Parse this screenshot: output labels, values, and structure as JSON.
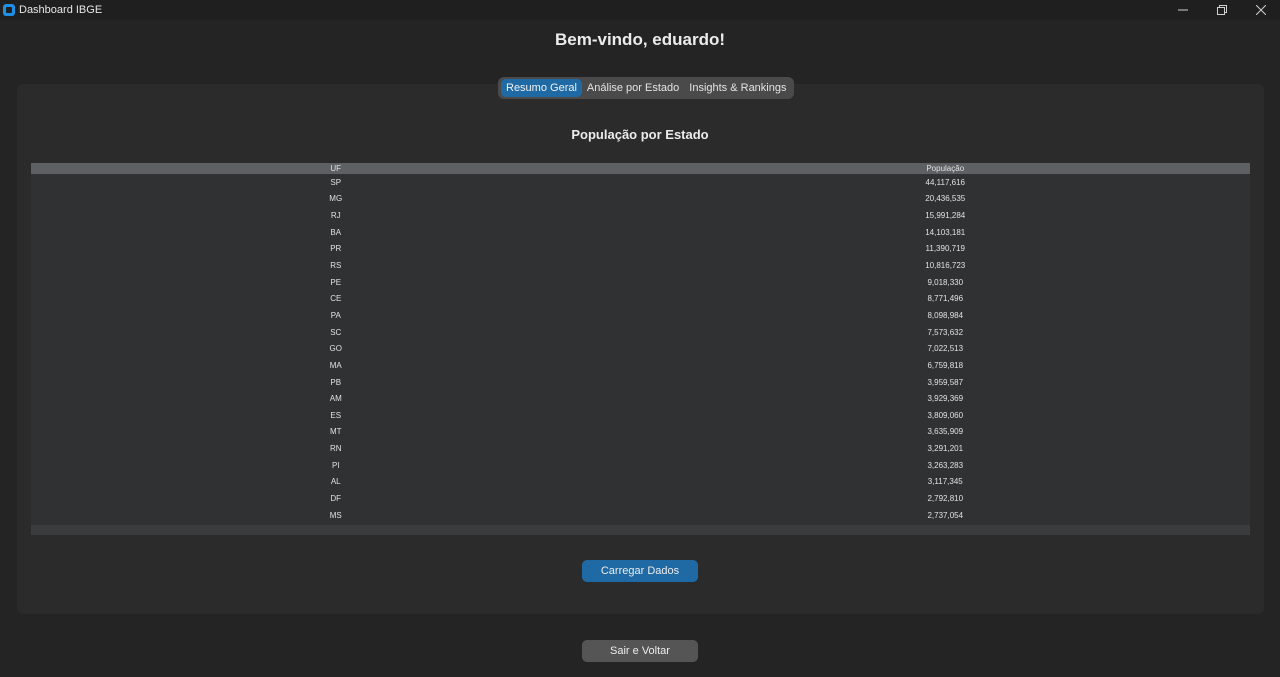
{
  "window": {
    "title": "Dashboard IBGE"
  },
  "welcome": "Bem-vindo, eduardo!",
  "tabs": [
    {
      "label": "Resumo Geral",
      "active": true
    },
    {
      "label": "Análise por Estado",
      "active": false
    },
    {
      "label": "Insights & Rankings",
      "active": false
    }
  ],
  "section_title": "População por Estado",
  "table": {
    "headers": [
      "UF",
      "População"
    ],
    "rows": [
      [
        "SP",
        "44,117,616"
      ],
      [
        "MG",
        "20,436,535"
      ],
      [
        "RJ",
        "15,991,284"
      ],
      [
        "BA",
        "14,103,181"
      ],
      [
        "PR",
        "11,390,719"
      ],
      [
        "RS",
        "10,816,723"
      ],
      [
        "PE",
        "9,018,330"
      ],
      [
        "CE",
        "8,771,496"
      ],
      [
        "PA",
        "8,098,984"
      ],
      [
        "SC",
        "7,573,632"
      ],
      [
        "GO",
        "7,022,513"
      ],
      [
        "MA",
        "6,759,818"
      ],
      [
        "PB",
        "3,959,587"
      ],
      [
        "AM",
        "3,929,369"
      ],
      [
        "ES",
        "3,809,060"
      ],
      [
        "MT",
        "3,635,909"
      ],
      [
        "RN",
        "3,291,201"
      ],
      [
        "PI",
        "3,263,283"
      ],
      [
        "AL",
        "3,117,345"
      ],
      [
        "DF",
        "2,792,810"
      ],
      [
        "MS",
        "2,737,054"
      ]
    ]
  },
  "buttons": {
    "load": "Carregar Dados",
    "exit": "Sair e Voltar"
  },
  "colors": {
    "accent": "#1f6aa5",
    "background": "#242424",
    "panel": "#2b2b2b"
  }
}
